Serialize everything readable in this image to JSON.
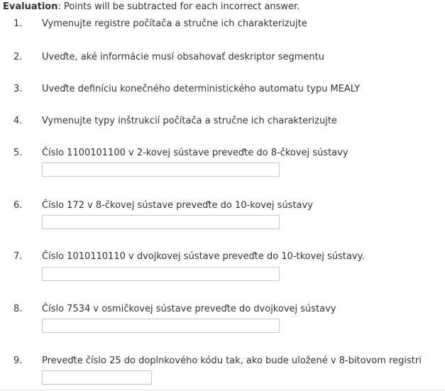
{
  "header": {
    "label": "Evaluation",
    "text": ": Points will be subtracted for each incorrect answer."
  },
  "questions": [
    {
      "number": "1.",
      "text": "Vymenujte registre počítača a stručne ich charakterizujte"
    },
    {
      "number": "2.",
      "text": "Uveďte, aké informácie musí obsahovať deskriptor segmentu"
    },
    {
      "number": "3.",
      "text": "Uveďte definíciu konečného deterministického automatu typu MEALY"
    },
    {
      "number": "4.",
      "text": "Vymenujte typy inštrukcií počítača a stručne ich charakterizujte"
    },
    {
      "number": "5.",
      "text": "Číslo 1100101100 v 2-kovej sústave preveďte do 8-čkovej sústavy",
      "answer_value": ""
    },
    {
      "number": "6.",
      "text": "Číslo 172 v 8-čkovej sústave preveďte do 10-kovej sústavy",
      "answer_value": ""
    },
    {
      "number": "7.",
      "text": "Číslo 1010110110 v dvojkovej sústave preveďte do 10-tkovej sústavy.",
      "answer_value": ""
    },
    {
      "number": "8.",
      "text": "Číslo 7534 v osmičkovej sústave preveďte do dvojkovej sústavy",
      "answer_value": ""
    },
    {
      "number": "9.",
      "text": "Preveďte číslo 25 do doplnkového kódu tak, ako bude uložené v 8-bitovom registri",
      "answer_value": ""
    }
  ]
}
